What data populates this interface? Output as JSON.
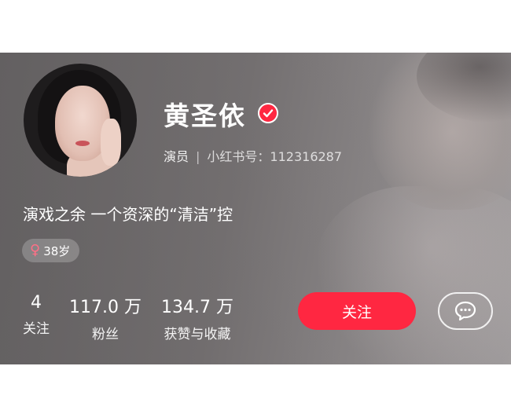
{
  "profile": {
    "name": "黄圣依",
    "role": "演员",
    "id_label": "小红书号：",
    "id_value": "112316287",
    "bio": "演戏之余 一个资深的“清洁”控",
    "tag": {
      "symbol": "♀",
      "age": "38岁"
    }
  },
  "stats": [
    {
      "value": "4",
      "label": "关注"
    },
    {
      "value": "117.0 万",
      "label": "粉丝"
    },
    {
      "value": "134.7 万",
      "label": "获赞与收藏"
    }
  ],
  "actions": {
    "follow_label": "关注",
    "chat_icon": "chat-bubble-icon"
  },
  "colors": {
    "accent": "#ff2741",
    "female": "#ff6f86"
  }
}
